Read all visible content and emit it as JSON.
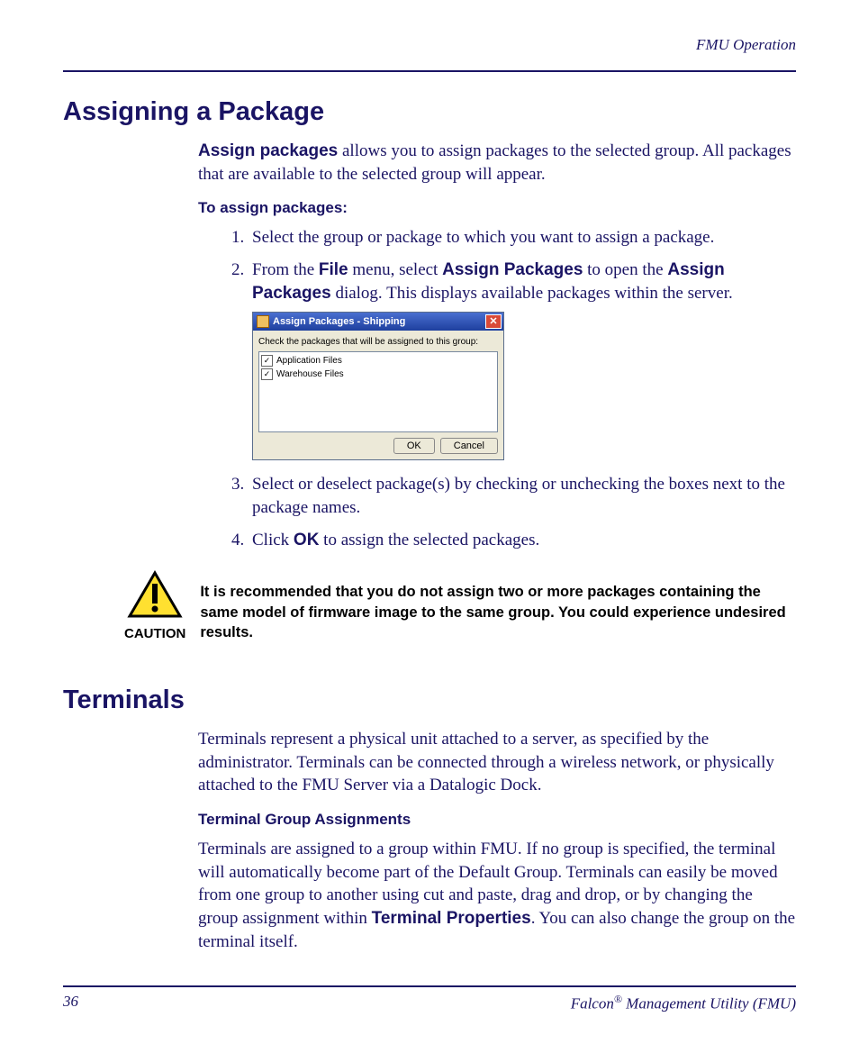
{
  "header": {
    "section": "FMU Operation"
  },
  "section1": {
    "title": "Assigning a Package",
    "intro_bold": "Assign packages",
    "intro_rest": " allows you to assign packages to the selected group. All packages that are available to the selected group will appear.",
    "subhead": "To assign packages:",
    "steps": {
      "s1": "Select the group or package to which you want to assign a package.",
      "s2_a": "From the ",
      "s2_b": "File",
      "s2_c": " menu, select ",
      "s2_d": "Assign Packages",
      "s2_e": " to open the ",
      "s2_f": "Assign Packages",
      "s2_g": " dialog. This displays available packages within the server.",
      "s3": "Select or deselect package(s) by checking or unchecking the boxes next to the package names.",
      "s4_a": "Click ",
      "s4_b": "OK",
      "s4_c": " to assign the selected packages."
    }
  },
  "dialog": {
    "title": "Assign Packages - Shipping",
    "instruction": "Check the packages that will be assigned to this group:",
    "item1": "Application Files",
    "item2": "Warehouse Files",
    "ok": "OK",
    "cancel": "Cancel"
  },
  "caution": {
    "label": "CAUTION",
    "text": "It is recommended that you do not assign two or more packages containing the same model of firmware image to the same group. You could experience undesired results."
  },
  "section2": {
    "title": "Terminals",
    "p1": "Terminals represent a physical unit attached to a server, as specified by the administrator. Terminals can be connected through a wireless network, or physically attached to the FMU Server via a Datalogic Dock.",
    "subhead": "Terminal Group Assignments",
    "p2_a": "Terminals are assigned to a group within FMU. If no group is specified, the terminal will automatically become part of the Default Group. Terminals can easily be moved from one group to another using cut and paste, drag and drop, or by changing the group assignment within ",
    "p2_b": "Terminal Properties",
    "p2_c": ". You can also change the group on the terminal itself."
  },
  "footer": {
    "page": "36",
    "product_a": "Falcon",
    "product_b": " Management Utility (FMU)"
  }
}
